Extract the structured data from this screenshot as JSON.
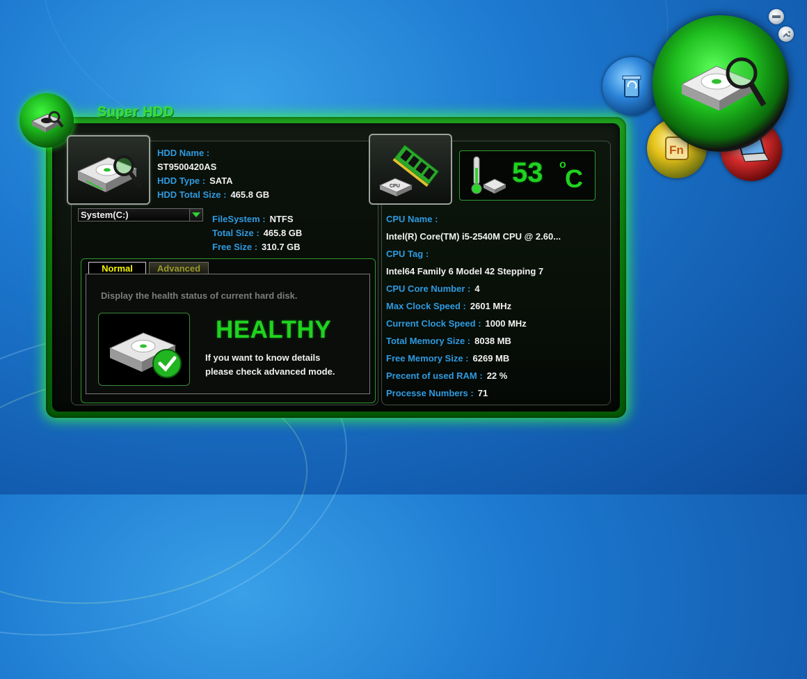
{
  "app": {
    "title": "Super HDD"
  },
  "hdd": {
    "name_label": "HDD Name :",
    "name_value": "ST9500420AS",
    "type_label": "HDD Type :",
    "type_value": "SATA",
    "total_label": "HDD Total Size :",
    "total_value": "465.8 GB"
  },
  "drive": {
    "selected": "System(C:)",
    "filesystem_label": "FileSystem :",
    "filesystem_value": "NTFS",
    "total_label": "Total Size :",
    "total_value": "465.8 GB",
    "free_label": "Free Size :",
    "free_value": "310.7 GB"
  },
  "tabs": {
    "normal": "Normal",
    "advanced": "Advanced"
  },
  "health": {
    "description": "Display the health status of current hard disk.",
    "status": "HEALTHY",
    "hint_line1": "If you want to know details",
    "hint_line2": "please check advanced mode."
  },
  "temperature": {
    "value": "53",
    "unit": "C",
    "degree": "o"
  },
  "cpu": {
    "name_label": "CPU Name :",
    "name_value": "Intel(R) Core(TM) i5-2540M CPU @ 2.60...",
    "tag_label": "CPU Tag :",
    "tag_value": "Intel64 Family 6 Model 42 Stepping 7",
    "cores_label": "CPU Core Number :",
    "cores_value": "4",
    "max_clock_label": "Max Clock Speed :",
    "max_clock_value": "2601 MHz",
    "cur_clock_label": "Current Clock Speed :",
    "cur_clock_value": "1000 MHz",
    "total_mem_label": "Total Memory Size :",
    "total_mem_value": "8038 MB",
    "free_mem_label": "Free Memory Size :",
    "free_mem_value": "6269 MB",
    "ram_used_label": "Precent of used RAM :",
    "ram_used_value": "22 %",
    "proc_label": "Processe Numbers :",
    "proc_value": "71"
  },
  "icons": {
    "chip_label": "CPU",
    "fn_label": "Fn"
  },
  "colors": {
    "accent_green": "#1fd31f",
    "label_blue": "#2f9ae0",
    "tab_active": "#f5f500"
  }
}
